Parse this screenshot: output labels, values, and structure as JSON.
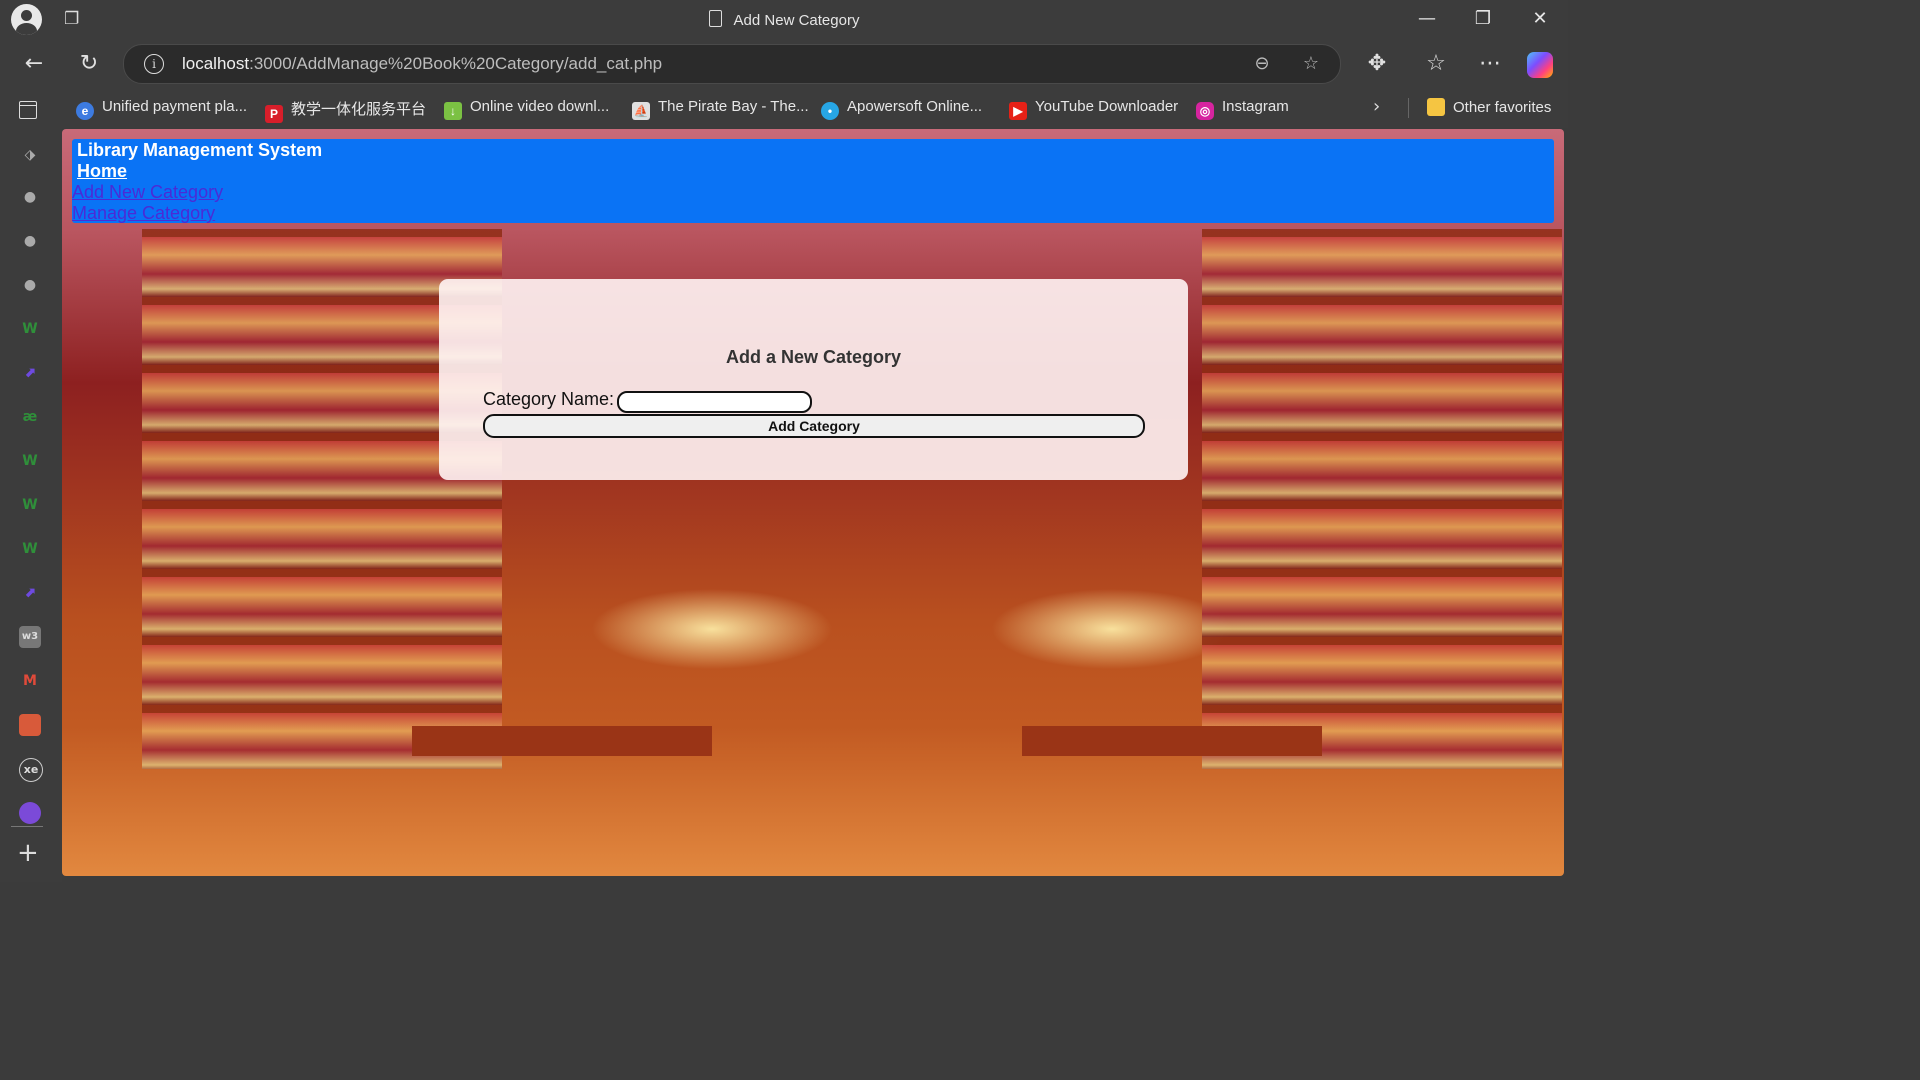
{
  "window": {
    "title": "Add New Category",
    "url_host": "localhost",
    "url_path": ":3000/AddManage%20Book%20Category/add_cat.php"
  },
  "bookmarks": [
    {
      "label": "Unified payment pla...",
      "icon": "payment-icon",
      "color": "#3d7be0"
    },
    {
      "label": "教学一体化服务平台",
      "icon": "p-logo-icon",
      "color": "#d81e2a"
    },
    {
      "label": "Online video downl...",
      "icon": "download-arrow-icon",
      "color": "#7bc143"
    },
    {
      "label": "The Pirate Bay - The...",
      "icon": "pirate-ship-icon",
      "color": "#e0e0e0"
    },
    {
      "label": "Apowersoft Online...",
      "icon": "apowersoft-icon",
      "color": "#27a6e5"
    },
    {
      "label": "YouTube Downloader",
      "icon": "youtube-icon",
      "color": "#e62117"
    },
    {
      "label": "Instagram",
      "icon": "instagram-icon",
      "color": "#d6249f"
    }
  ],
  "other_favorites": "Other favorites",
  "site": {
    "title": "Library Management System",
    "home": "Home",
    "add_link": "Add New Category",
    "manage_link": "Manage Category"
  },
  "form": {
    "heading": "Add a New Category",
    "label": "Category Name:",
    "input_value": "",
    "button": "Add Category"
  },
  "colors": {
    "header_bg": "#0a73f5",
    "link": "#4a2bd6",
    "card_bg": "#fff4f4"
  }
}
